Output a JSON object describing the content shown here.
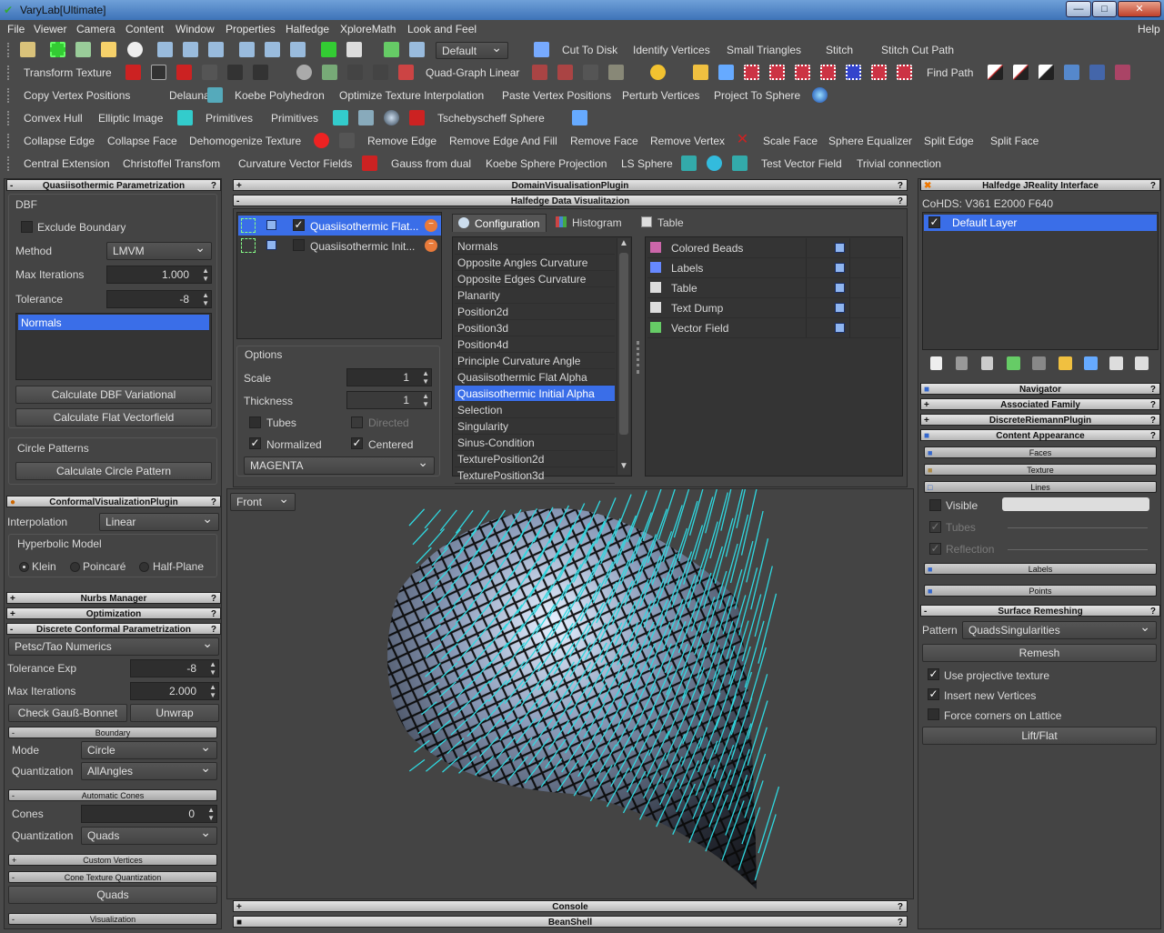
{
  "window": {
    "title": "VaryLab[Ultimate]"
  },
  "menu": {
    "items": [
      "File",
      "Viewer",
      "Camera",
      "Content",
      "Window",
      "Properties",
      "Halfedge",
      "XploreMath",
      "Look and Feel"
    ],
    "help": "Help"
  },
  "toolbar": {
    "viewer_combo": "Default",
    "row1": [
      "Cut To Disk",
      "Identify Vertices",
      "Small Triangles",
      "Stitch",
      "Stitch Cut Path"
    ],
    "row2": [
      "Transform Texture",
      "Quad-Graph Linear",
      "Find Path"
    ],
    "row3": [
      "Copy Vertex Positions",
      "Delaunay",
      "Koebe Polyhedron",
      "Optimize Texture Interpolation",
      "Paste Vertex Positions",
      "Perturb Vertices",
      "Project To Sphere"
    ],
    "row4": [
      "Convex Hull",
      "Elliptic Image",
      "Primitives",
      "Primitives",
      "Tschebyscheff Sphere"
    ],
    "row5": [
      "Collapse Edge",
      "Collapse Face",
      "Dehomogenize Texture",
      "Remove Edge",
      "Remove Edge And Fill",
      "Remove Face",
      "Remove Vertex",
      "Scale Face",
      "Sphere Equalizer",
      "Split Edge",
      "Split Face"
    ],
    "row6": [
      "Central Extension",
      "Christoffel Transfom",
      "Curvature Vector Fields",
      "Gauss from dual",
      "Koebe Sphere Projection",
      "LS Sphere",
      "Test Vector Field",
      "Trivial connection"
    ]
  },
  "left": {
    "qp": {
      "title": "Quasiisothermic Parametrization",
      "dbf": "DBF",
      "exclude": "Exclude Boundary",
      "method_label": "Method",
      "method": "LMVM",
      "maxit_label": "Max Iterations",
      "maxit": "1.000",
      "tol_label": "Tolerance",
      "tol": "-8",
      "list": "Normals",
      "btn_dbf": "Calculate DBF Variational",
      "btn_flat": "Calculate Flat Vectorfield",
      "circle": "Circle Patterns",
      "btn_circle": "Calculate Circle Pattern"
    },
    "cv": {
      "title": "ConformalVisualizationPlugin",
      "interp_label": "Interpolation",
      "interp": "Linear",
      "hyper": "Hyperbolic Model",
      "klein": "Klein",
      "poincare": "Poincaré",
      "half": "Half-Plane"
    },
    "nurbs": "Nurbs Manager",
    "optimization": "Optimization",
    "dcp": {
      "title": "Discrete Conformal Parametrization",
      "numerics": "Petsc/Tao Numerics",
      "tolexp_label": "Tolerance Exp",
      "tolexp": "-8",
      "maxit_label": "Max Iterations",
      "maxit": "2.000",
      "btn_check": "Check Gauß-Bonnet",
      "btn_unwrap": "Unwrap",
      "boundary": "Boundary",
      "mode_label": "Mode",
      "mode": "Circle",
      "quant_label": "Quantization",
      "quant": "AllAngles",
      "auto": "Automatic Cones",
      "cones_label": "Cones",
      "cones": "0",
      "quant2_label": "Quantization",
      "quant2": "Quads",
      "custom": "Custom Vertices",
      "conetex": "Cone Texture Quantization",
      "quads_btn": "Quads",
      "vis": "Visualization"
    }
  },
  "center": {
    "dv": "DomainVisualisationPlugin",
    "hdv": "Halfedge Data Visualitazion",
    "layers": [
      "Quasiisothermic Flat...",
      "Quasiisothermic Init..."
    ],
    "options": {
      "title": "Options",
      "scale_label": "Scale",
      "scale": "1",
      "thick_label": "Thickness",
      "thick": "1",
      "tubes": "Tubes",
      "directed": "Directed",
      "normalized": "Normalized",
      "centered": "Centered",
      "color": "MAGENTA"
    },
    "tabs": [
      "Configuration",
      "Histogram",
      "Table"
    ],
    "datalist": [
      "Normals",
      "Opposite Angles Curvature",
      "Opposite Edges Curvature",
      "Planarity",
      "Position2d",
      "Position3d",
      "Position4d",
      "Principle Curvature Angle",
      "Quasiisothermic Flat Alpha",
      "Quasiisothermic Initial Alpha",
      "Selection",
      "Singularity",
      "Sinus-Condition",
      "TexturePosition2d",
      "TexturePosition3d"
    ],
    "selected": "Quasiisothermic Initial Alpha",
    "vis": [
      "Colored Beads",
      "Labels",
      "Table",
      "Text Dump",
      "Vector Field"
    ],
    "view": "Front",
    "console": "Console",
    "beanshell": "BeanShell"
  },
  "right": {
    "hji": "Halfedge JReality Interface",
    "cohds": "CoHDS: V361 E2000 F640",
    "layer": "Default Layer",
    "navigator": "Navigator",
    "family": "Associated Family",
    "riemann": "DiscreteRiemannPlugin",
    "appearance": "Content Appearance",
    "faces": "Faces",
    "texture": "Texture",
    "lines": "Lines",
    "visible": "Visible",
    "tubes": "Tubes",
    "reflection": "Reflection",
    "labels": "Labels",
    "points": "Points",
    "sr": {
      "title": "Surface Remeshing",
      "pattern_label": "Pattern",
      "pattern": "QuadsSingularities",
      "remesh": "Remesh",
      "projective": "Use projective texture",
      "insert": "Insert new Vertices",
      "force": "Force corners on Lattice",
      "lift": "Lift/Flat"
    }
  },
  "colors": {
    "accent": "#3a6ee8",
    "vectors": "#2fd8e0",
    "window_bg": "#4a4a4a"
  }
}
